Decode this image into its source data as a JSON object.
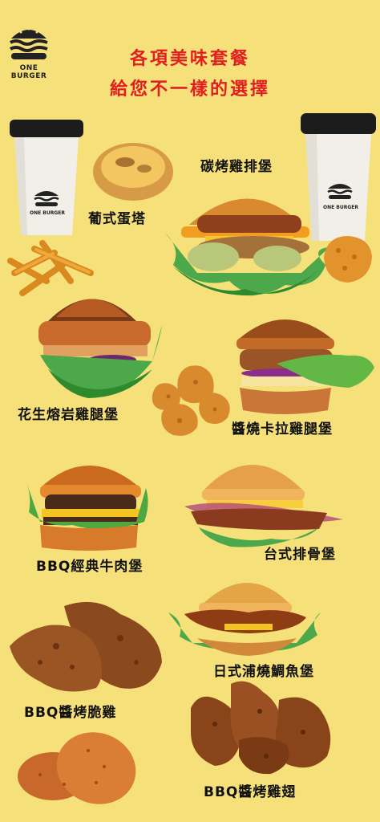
{
  "brand": {
    "name": "ONE BURGER"
  },
  "titles": {
    "line1": "各項美味套餐",
    "line2": "給您不一樣的選擇"
  },
  "items": {
    "egg_tart": "葡式蛋塔",
    "charcoal_chicken_burger": "碳烤雞排堡",
    "peanut_lava_chicken_burger": "花生熔岩雞腿堡",
    "sauce_karaage_chicken_burger": "醬燒卡拉雞腿堡",
    "bbq_beef_burger": "BBQ經典牛肉堡",
    "taiwanese_pork_burger": "台式排骨堡",
    "japanese_eel_burger": "日式浦燒鯛魚堡",
    "bbq_crispy_chicken": "BBQ醬烤脆雞",
    "bbq_chicken_wings": "BBQ醬烤雞翅"
  },
  "cup_logo_text": "ONE BURGER"
}
